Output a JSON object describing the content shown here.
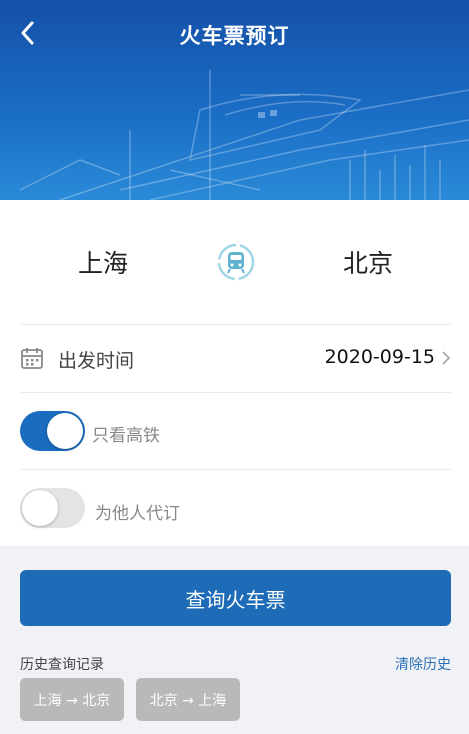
{
  "header": {
    "title": "火车票预订",
    "back_icon": "chevron-left-icon"
  },
  "route": {
    "from": "上海",
    "to": "北京",
    "swap_icon": "train-swap-icon"
  },
  "departure": {
    "label": "出发时间",
    "value": "2020-09-15",
    "icon": "calendar-icon"
  },
  "options": [
    {
      "label": "只看高铁",
      "checked": true
    },
    {
      "label": "为他人代订",
      "checked": false
    }
  ],
  "search_button": "查询火车票",
  "history": {
    "label": "历史查询记录",
    "clear": "清除历史",
    "items": [
      "上海 → 北京",
      "北京 → 上海"
    ]
  },
  "colors": {
    "brand": "#1e6bb8",
    "toggle_on": "#1a6cbf",
    "chip": "#b9b9b9",
    "link": "#2b6fb5"
  }
}
